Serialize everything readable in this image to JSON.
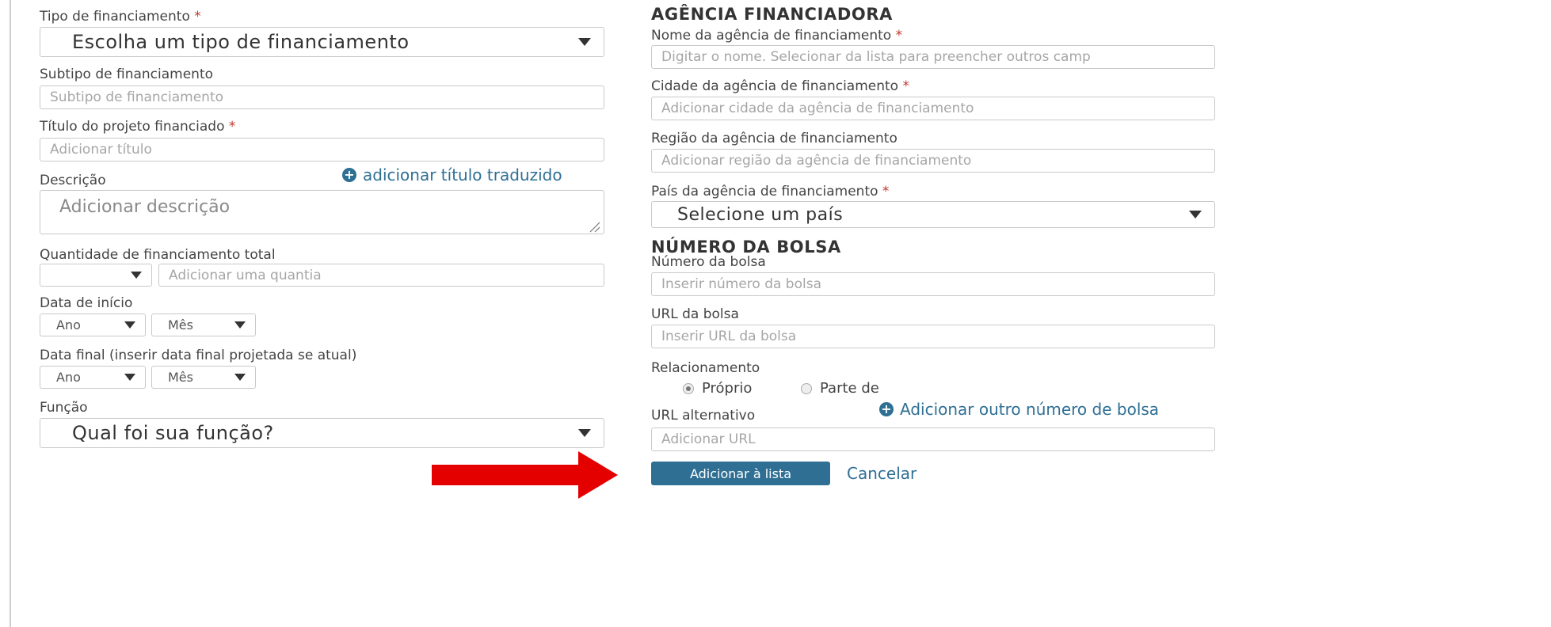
{
  "left": {
    "funding_type": {
      "label": "Tipo de financiamento",
      "required": "*",
      "selected": "Escolha um tipo de financiamento"
    },
    "funding_subtype": {
      "label": "Subtipo de financiamento",
      "placeholder": "Subtipo de financiamento"
    },
    "project_title": {
      "label": "Título do projeto financiado",
      "required": "*",
      "placeholder": "Adicionar título"
    },
    "add_translated_title": "adicionar título traduzido",
    "description": {
      "label": "Descrição",
      "placeholder": "Adicionar descrição"
    },
    "total_amount": {
      "label": "Quantidade de financiamento total",
      "currency_selected": "",
      "placeholder": "Adicionar uma quantia"
    },
    "start_date": {
      "label": "Data de início",
      "year": "Ano",
      "month": "Mês"
    },
    "end_date": {
      "label": "Data final (inserir data final projetada se atual)",
      "year": "Ano",
      "month": "Mês"
    },
    "role": {
      "label": "Função",
      "selected": "Qual foi sua função?"
    }
  },
  "right": {
    "agency_heading": "AGÊNCIA FINANCIADORA",
    "agency_name": {
      "label": "Nome da agência de financiamento",
      "required": "*",
      "placeholder": "Digitar o nome. Selecionar da lista para preencher outros camp"
    },
    "agency_city": {
      "label": "Cidade da agência de financiamento",
      "required": "*",
      "placeholder": "Adicionar cidade da agência de financiamento"
    },
    "agency_region": {
      "label": "Região da agência de financiamento",
      "placeholder": "Adicionar região da agência de financiamento"
    },
    "agency_country": {
      "label": "País da agência de financiamento",
      "required": "*",
      "selected": "Selecione um país"
    },
    "grant_heading": "NÚMERO DA BOLSA",
    "grant_number": {
      "label": "Número da bolsa",
      "placeholder": "Inserir número da bolsa"
    },
    "grant_url": {
      "label": "URL da bolsa",
      "placeholder": "Inserir URL da bolsa"
    },
    "relationship": {
      "label": "Relacionamento",
      "option_self": "Próprio",
      "option_part_of": "Parte de",
      "selected": "Próprio"
    },
    "add_grant_number": "Adicionar outro número de bolsa",
    "alt_url": {
      "label": "URL alternativo",
      "placeholder": "Adicionar URL"
    },
    "add_to_list_button": "Adicionar à lista",
    "cancel_link": "Cancelar"
  },
  "colors": {
    "accent": "#2e6f94",
    "required": "#c0392b",
    "arrow": "#e50000"
  }
}
